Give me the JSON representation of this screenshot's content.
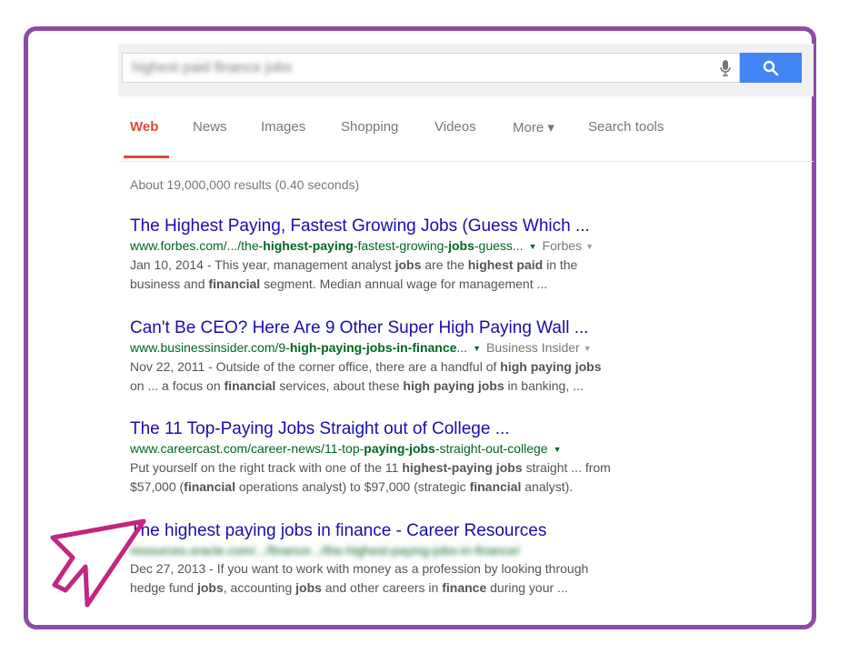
{
  "search": {
    "query": "highest paid finance jobs"
  },
  "tabs": [
    {
      "label": "Web"
    },
    {
      "label": "News"
    },
    {
      "label": "Images"
    },
    {
      "label": "Shopping"
    },
    {
      "label": "Videos"
    },
    {
      "label": "More ▾"
    },
    {
      "label": "Search tools"
    }
  ],
  "stats": "About 19,000,000 results (0.40 seconds)",
  "results": [
    {
      "title": "The Highest Paying, Fastest Growing Jobs (Guess Which ...",
      "url_pre": "www.forbes.com/.../the-",
      "url_b1": "highest-paying",
      "url_mid": "-fastest-growing-",
      "url_b2": "jobs",
      "url_post": "-guess...",
      "source": "Forbes",
      "snippet1_a": "Jan 10, 2014 - This year, management analyst ",
      "snippet1_b1": "jobs",
      "snippet1_c": " are the ",
      "snippet1_b2": "highest paid",
      "snippet1_d": " in the",
      "snippet2_a": "business and ",
      "snippet2_b1": "financial",
      "snippet2_c": " segment. Median annual wage for management ..."
    },
    {
      "title": "Can't Be CEO? Here Are 9 Other Super High Paying Wall ...",
      "url_pre": "www.businessinsider.com/9-",
      "url_b1": "high-paying-jobs-in-finance",
      "url_post": "...",
      "source": "Business Insider",
      "snippet1_a": "Nov 22, 2011 - Outside of the corner office, there are a handful of ",
      "snippet1_b1": "high paying jobs",
      "snippet2_a": "on ... a focus on ",
      "snippet2_b1": "financial",
      "snippet2_c": " services, about these ",
      "snippet2_b2": "high paying jobs",
      "snippet2_d": " in banking, ..."
    },
    {
      "title": "The 11 Top-Paying Jobs Straight out of College ...",
      "url_pre": "www.careercast.com/career-news/11-top-",
      "url_b1": "paying-jobs",
      "url_post": "-straight-out-college",
      "snippet1_a": "Put yourself on the right track with one of the 11 ",
      "snippet1_b1": "highest-paying jobs",
      "snippet1_c": " straight ... from",
      "snippet2_a": "$57,000 (",
      "snippet2_b1": "financial",
      "snippet2_c": " operations analyst) to $97,000 (strategic ",
      "snippet2_b2": "financial",
      "snippet2_d": " analyst)."
    },
    {
      "title": "The highest paying jobs in finance - Career Resources",
      "url_blurred": "resources.oracle.com/.../finance.../the-highest-paying-jobs-in-finance/",
      "snippet1_a": "Dec 27, 2013 - If you want to work with money as a profession by looking through",
      "snippet2_a": "hedge fund ",
      "snippet2_b1": "jobs",
      "snippet2_c": ", accounting ",
      "snippet2_b2": "jobs",
      "snippet2_d": " and other careers in ",
      "snippet2_b3": "finance",
      "snippet2_e": " during your ..."
    }
  ],
  "colors": {
    "frame": "#8e4ba5",
    "arrow": "#c2267f",
    "link": "#1a0dab",
    "url": "#006621",
    "active_tab": "#dd4b39",
    "search_button": "#4285f4"
  }
}
